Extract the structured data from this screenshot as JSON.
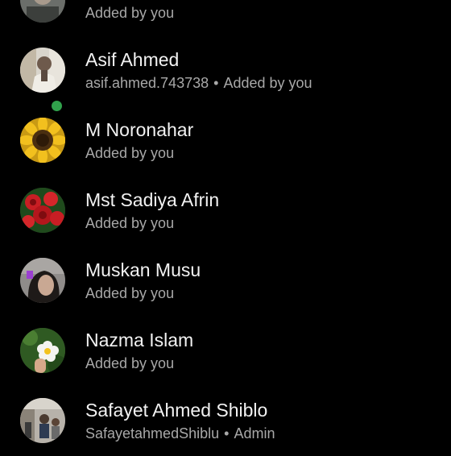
{
  "members": [
    {
      "name": "",
      "username": "",
      "role": "Added by you",
      "avatar_icon": "profile-photo",
      "online": false
    },
    {
      "name": "Asif Ahmed",
      "username": "asif.ahmed.743738",
      "role": "Added by you",
      "avatar_icon": "profile-photo-man",
      "online": true
    },
    {
      "name": "M Noronahar",
      "username": "",
      "role": "Added by you",
      "avatar_icon": "profile-photo-sunflower",
      "online": false
    },
    {
      "name": "Mst Sadiya Afrin",
      "username": "",
      "role": "Added by you",
      "avatar_icon": "profile-photo-red-roses",
      "online": false
    },
    {
      "name": "Muskan Musu",
      "username": "",
      "role": "Added by you",
      "avatar_icon": "profile-photo-girl",
      "online": false
    },
    {
      "name": "Nazma Islam",
      "username": "",
      "role": "Added by you",
      "avatar_icon": "profile-photo-white-flower",
      "online": false
    },
    {
      "name": "Safayet Ahmed Shiblo",
      "username": "SafayetahmedShiblu",
      "role": "Admin",
      "avatar_icon": "profile-photo-group",
      "online": false
    }
  ],
  "separator": "•",
  "colors": {
    "background": "#000000",
    "name_text": "#f2f2f2",
    "subtitle_text": "#a8a8a8",
    "online_indicator": "#31a24c"
  }
}
